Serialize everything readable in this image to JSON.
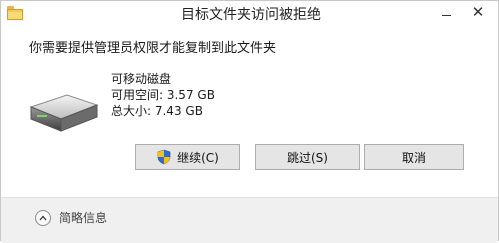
{
  "window": {
    "title": "目标文件夹访问被拒绝",
    "minimize_glyph": "",
    "close_glyph": "✕"
  },
  "message": "你需要提供管理员权限才能复制到此文件夹",
  "drive": {
    "name": "可移动磁盘",
    "free_space": "可用空间: 3.57 GB",
    "total_size": "总大小: 7.43 GB",
    "icon": "removable-drive-icon"
  },
  "buttons": {
    "continue": "继续(C)",
    "skip": "跳过(S)",
    "cancel": "取消"
  },
  "footer": {
    "details_label": "简略信息"
  },
  "colors": {
    "background": "#ffffff",
    "footer": "#f0f0f0",
    "button": "#e5e5e5",
    "shield_blue": "#2f6bd1",
    "shield_yellow": "#f2c21a"
  }
}
